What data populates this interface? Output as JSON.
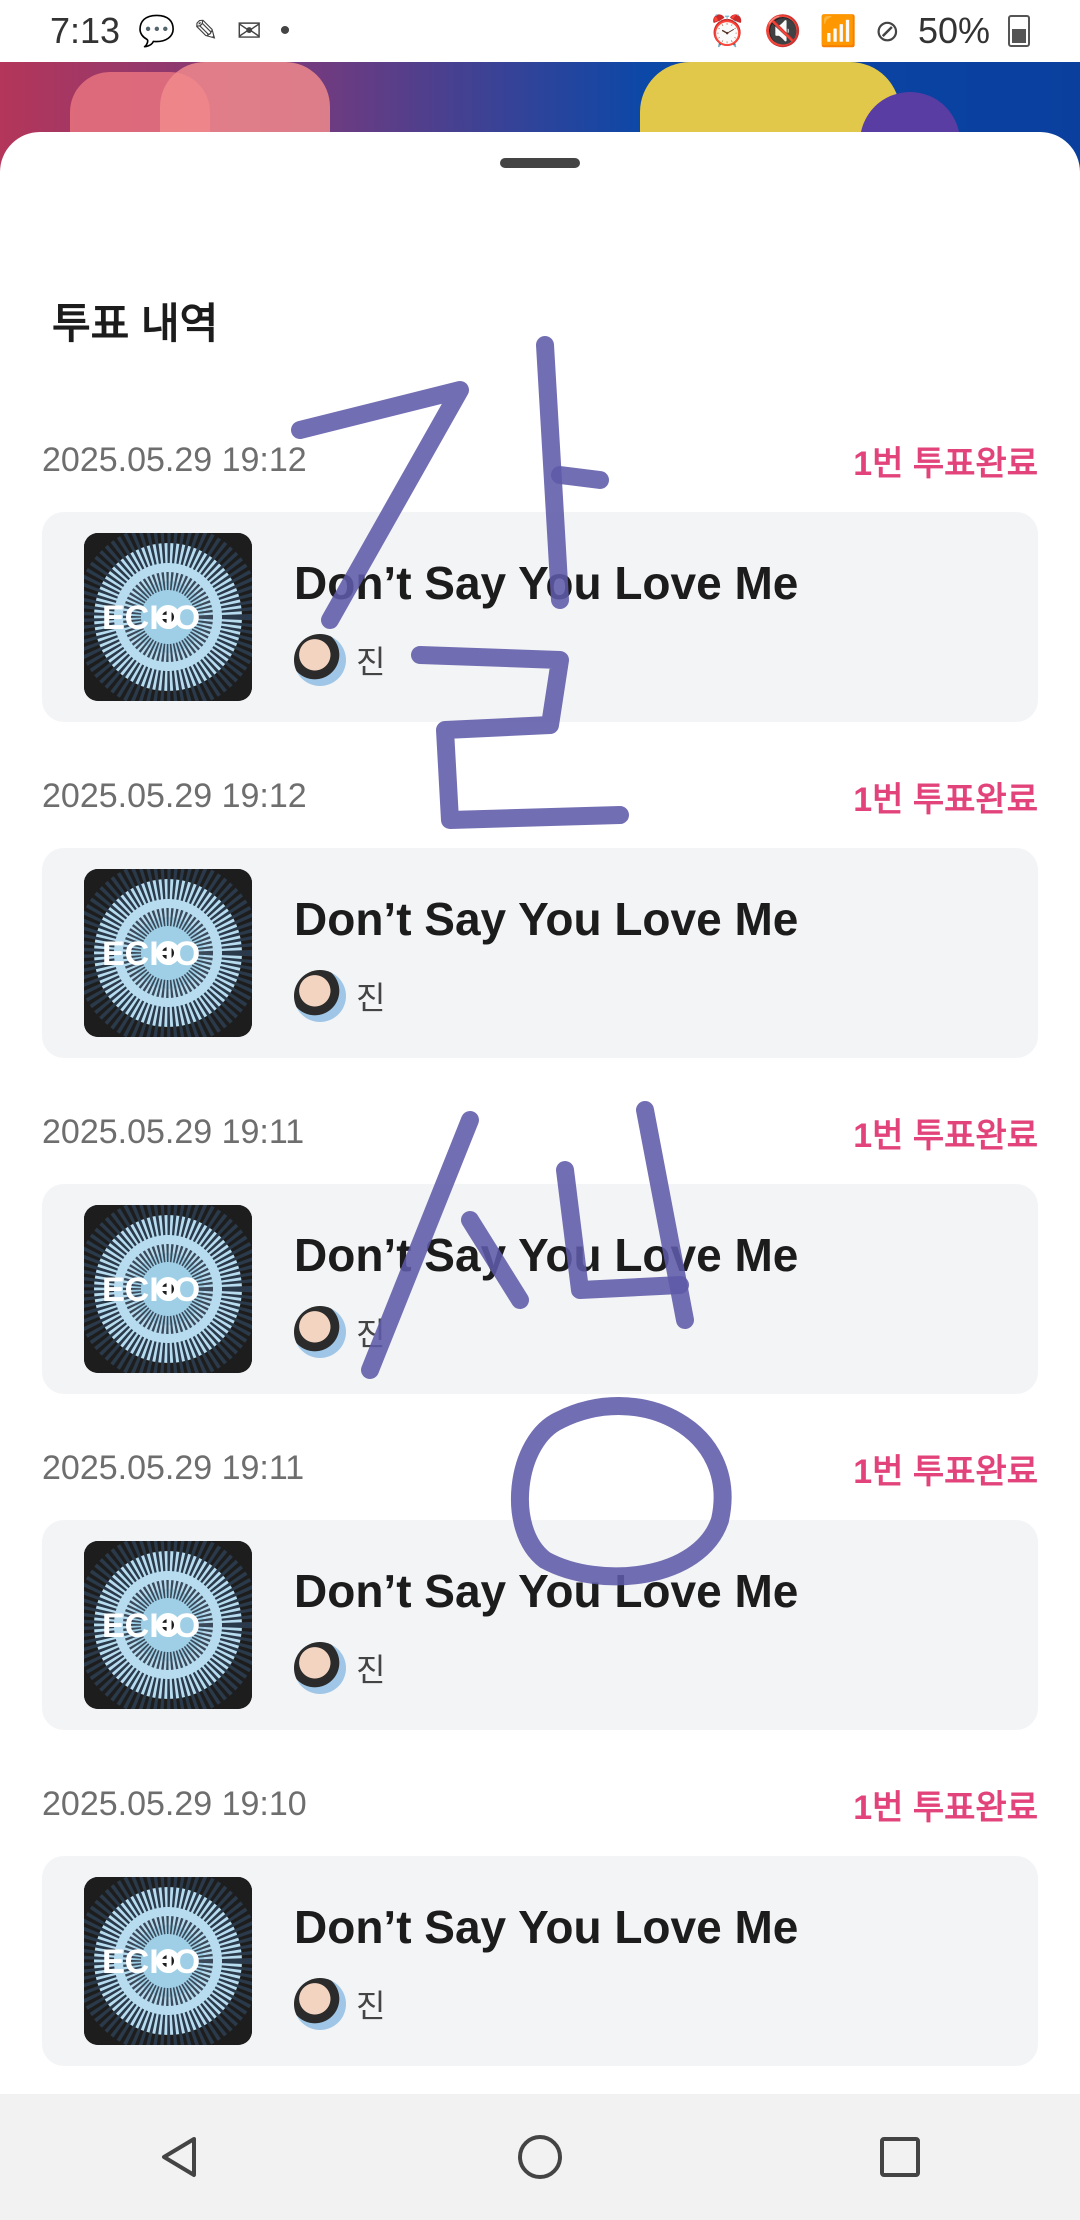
{
  "status_bar": {
    "time": "7:13",
    "battery": "50%",
    "left_icons": [
      "chat-icon",
      "profile-icon",
      "gmail-icon",
      "dot-icon"
    ],
    "right_icons": [
      "alarm-icon",
      "mute-icon",
      "wifi-icon",
      "no-disturb-icon",
      "battery-icon"
    ]
  },
  "sheet": {
    "title": "투표 내역"
  },
  "entries": [
    {
      "date": "2025.05.29 19:12",
      "status": "1번 투표완료",
      "song": "Don’t Say You Love Me",
      "artist": "진",
      "album_text": "ECHO"
    },
    {
      "date": "2025.05.29 19:12",
      "status": "1번 투표완료",
      "song": "Don’t Say You Love Me",
      "artist": "진",
      "album_text": "ECHO"
    },
    {
      "date": "2025.05.29 19:11",
      "status": "1번 투표완료",
      "song": "Don’t Say You Love Me",
      "artist": "진",
      "album_text": "ECHO"
    },
    {
      "date": "2025.05.29 19:11",
      "status": "1번 투표완료",
      "song": "Don’t Say You Love Me",
      "artist": "진",
      "album_text": "ECHO"
    },
    {
      "date": "2025.05.29 19:10",
      "status": "1번 투표완료",
      "song": "Don’t Say You Love Me",
      "artist": "진",
      "album_text": "ECHO"
    }
  ],
  "handwriting": {
    "text": "잘 생 ...",
    "color": "#5f5aa8"
  },
  "navbar": {
    "buttons": [
      "back-icon",
      "home-icon",
      "recents-icon"
    ]
  },
  "colors": {
    "accent": "#e2437a",
    "card_bg": "#f3f4f6"
  }
}
